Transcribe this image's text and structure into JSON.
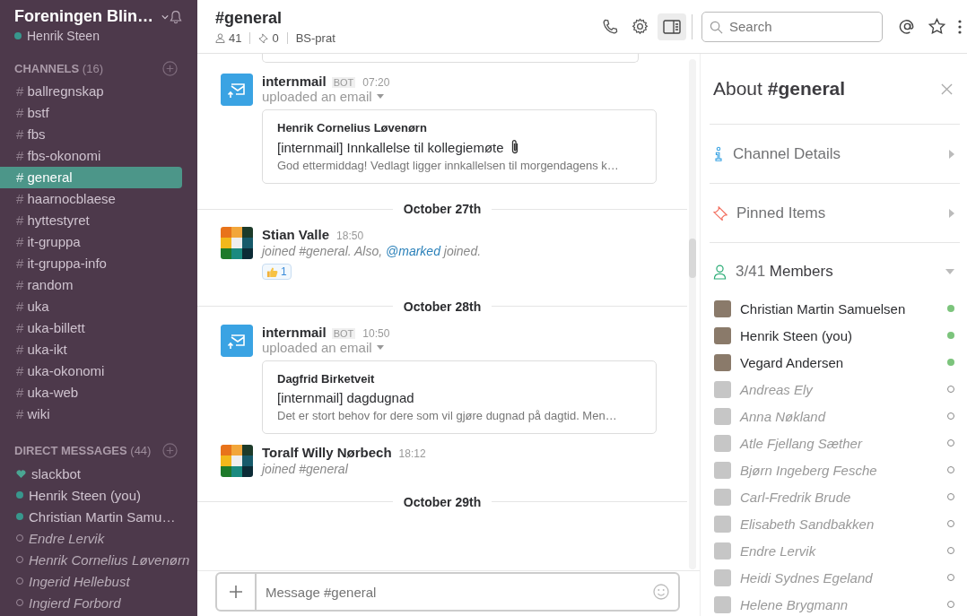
{
  "workspace": {
    "name": "Foreningen Blin…",
    "user": "Henrik Steen"
  },
  "channels": {
    "heading": "CHANNELS",
    "count": "(16)",
    "items": [
      {
        "prefix": "#",
        "name": "ballregnskap",
        "selected": false
      },
      {
        "prefix": "#",
        "name": "bstf",
        "selected": false
      },
      {
        "prefix": "#",
        "name": "fbs",
        "selected": false
      },
      {
        "prefix": "#",
        "name": "fbs-okonomi",
        "selected": false
      },
      {
        "prefix": "#",
        "name": "general",
        "selected": true
      },
      {
        "prefix": "#",
        "name": "haarnocblaese",
        "selected": false
      },
      {
        "prefix": "#",
        "name": "hyttestyret",
        "selected": false
      },
      {
        "prefix": "#",
        "name": "it-gruppa",
        "selected": false
      },
      {
        "prefix": "#",
        "name": "it-gruppa-info",
        "selected": false
      },
      {
        "prefix": "#",
        "name": "random",
        "selected": false
      },
      {
        "prefix": "#",
        "name": "uka",
        "selected": false
      },
      {
        "prefix": "#",
        "name": "uka-billett",
        "selected": false
      },
      {
        "prefix": "#",
        "name": "uka-ikt",
        "selected": false
      },
      {
        "prefix": "#",
        "name": "uka-okonomi",
        "selected": false
      },
      {
        "prefix": "#",
        "name": "uka-web",
        "selected": false
      },
      {
        "prefix": "#",
        "name": "wiki",
        "selected": false
      }
    ]
  },
  "direct_messages": {
    "heading": "DIRECT MESSAGES",
    "count": "(44)",
    "items": [
      {
        "name": "slackbot",
        "kind": "bot"
      },
      {
        "name": "Henrik Steen (you)",
        "kind": "online"
      },
      {
        "name": "Christian Martin Samu…",
        "kind": "online"
      },
      {
        "name": "Endre Lervik",
        "kind": "offline"
      },
      {
        "name": "Henrik Cornelius Løvenørn",
        "kind": "offline"
      },
      {
        "name": "Ingerid Hellebust",
        "kind": "offline"
      },
      {
        "name": "Ingierd Forbord",
        "kind": "offline"
      }
    ]
  },
  "channel_header": {
    "title": "#general",
    "members": "41",
    "pins": "0",
    "topic": "BS-prat"
  },
  "search": {
    "placeholder": "Search"
  },
  "messages": [
    {
      "kind": "upload",
      "author": "internmail",
      "badge": "BOT",
      "time": "07:20",
      "action": "uploaded an email",
      "email": {
        "from": "Henrik Cornelius Løvenørn",
        "subject": "[internmail] Innkallelse til kollegiemøte",
        "attachment": true,
        "preview": "God ettermiddag! Vedlagt ligger innkallelsen til morgendagens k…"
      }
    },
    {
      "kind": "date",
      "label": "October 27th"
    },
    {
      "kind": "join",
      "author": "Stian Valle",
      "time": "18:50",
      "text": "joined #general. Also, ",
      "mention": "@marked",
      "after": " joined.",
      "reaction": "1"
    },
    {
      "kind": "date",
      "label": "October 28th"
    },
    {
      "kind": "upload",
      "author": "internmail",
      "badge": "BOT",
      "time": "10:50",
      "action": "uploaded an email",
      "email": {
        "from": "Dagfrid Birketveit",
        "subject": "[internmail] dagdugnad",
        "attachment": false,
        "preview": "Det er stort behov for dere som vil gjøre dugnad på dagtid. Men…"
      }
    },
    {
      "kind": "join",
      "author": "Toralf Willy Nørbech",
      "time": "18:12",
      "text": "joined #general"
    },
    {
      "kind": "date",
      "label": "October 29th"
    }
  ],
  "composer": {
    "placeholder": "Message #general"
  },
  "about": {
    "title": "About",
    "channel": "#general",
    "sections": [
      {
        "kind": "details",
        "label": "Channel Details"
      },
      {
        "kind": "pinned",
        "label": "Pinned Items"
      }
    ],
    "members": {
      "count": "3/41",
      "label": "Members",
      "expanded": true,
      "items": [
        {
          "name": "Christian Martin Samuelsen",
          "online": true
        },
        {
          "name": "Henrik Steen (you)",
          "online": true
        },
        {
          "name": "Vegard Andersen",
          "online": true
        },
        {
          "name": "Andreas Ely",
          "online": false
        },
        {
          "name": "Anna Nøkland",
          "online": false
        },
        {
          "name": "Atle Fjellang Sæther",
          "online": false
        },
        {
          "name": "Bjørn Ingeberg Fesche",
          "online": false
        },
        {
          "name": "Carl-Fredrik Brude",
          "online": false
        },
        {
          "name": "Elisabeth Sandbakken",
          "online": false
        },
        {
          "name": "Endre Lervik",
          "online": false
        },
        {
          "name": "Heidi Sydnes Egeland",
          "online": false
        },
        {
          "name": "Helene Brygmann",
          "online": false
        }
      ]
    }
  }
}
